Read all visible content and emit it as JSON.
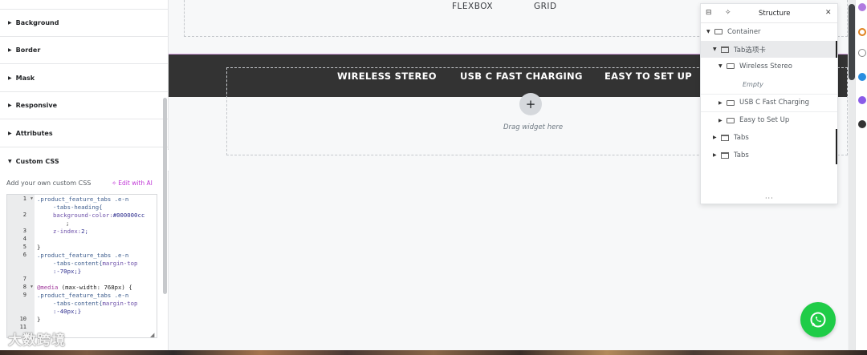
{
  "left_panel": {
    "sections": [
      {
        "label": "Background",
        "state": "collapsed"
      },
      {
        "label": "Border",
        "state": "collapsed"
      },
      {
        "label": "Mask",
        "state": "collapsed"
      },
      {
        "label": "Responsive",
        "state": "collapsed"
      },
      {
        "label": "Attributes",
        "state": "collapsed"
      },
      {
        "label": "Custom CSS",
        "state": "expanded"
      }
    ],
    "custom_css": {
      "description": "Add your own custom CSS",
      "edit_ai_label": "Edit with AI",
      "line_numbers": [
        "1",
        "2",
        "3",
        "4",
        "5",
        "6",
        "7",
        "8",
        "9",
        "10",
        "11"
      ],
      "code": {
        "l1a": ".product_feature_tabs .e-n",
        "l1b": "-tabs-heading{",
        "l2a": "background-color:",
        "l2b": "#000000cc",
        "l2c": ";",
        "l3a": "z-index:",
        "l3b": "2;",
        "l5": "}",
        "l6a": ".product_feature_tabs .e-n",
        "l6b": "-tabs-content{",
        "l6c": "margin-top",
        "l6d": ":-70px;}",
        "l8a": "@media",
        "l8b": " (max-width: 768px) {",
        "l9a": ".product_feature_tabs .e-n",
        "l9b": "-tabs-content{",
        "l9c": "margin-top",
        "l9d": ":-40px;}",
        "l10": "}"
      }
    },
    "watermark": "大数跨境"
  },
  "canvas": {
    "layout_options": [
      "FLEXBOX",
      "GRID"
    ],
    "tabs": [
      "WIRELESS STEREO",
      "USB C FAST CHARGING",
      "EASY TO SET UP"
    ],
    "drop_zone_label": "Drag widget here",
    "add_icon": "+"
  },
  "structure": {
    "title": "Structure",
    "tree": [
      {
        "label": "Container"
      },
      {
        "label": "Tab选项卡"
      },
      {
        "label": "Wireless Stereo"
      },
      {
        "label": "Empty"
      },
      {
        "label": "USB C Fast Charging"
      },
      {
        "label": "Easy to Set Up"
      },
      {
        "label": "Tabs"
      },
      {
        "label": "Tabs"
      }
    ],
    "more": "···"
  },
  "colors": {
    "tabs_bar": "#333333",
    "accent_purple": "#c036d6",
    "whatsapp": "#1fcc47"
  }
}
